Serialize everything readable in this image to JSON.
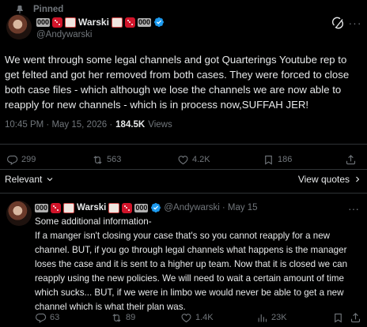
{
  "pinned": {
    "label": "Pinned"
  },
  "tweet": {
    "display_name": "Warski",
    "num_badge": "000",
    "handle": "@Andywarski",
    "text": "We went through some legal channels and got Quarterings Youtube rep to get felted and got her removed from both cases. They were forced to close both case files - which although we lose the channels we are now able to reapply for new channels - which is in process now,SUFFAH JER!",
    "time": "10:45 PM · May 15, 2026 ·",
    "views_count": "184.5K",
    "views_label": "Views",
    "stats": {
      "replies": "299",
      "reposts": "563",
      "likes": "4.2K",
      "bookmarks": "186"
    }
  },
  "controls": {
    "relevant": "Relevant",
    "view_quotes": "View quotes"
  },
  "reply": {
    "display_name": "Warski",
    "num_badge": "000",
    "handle": "@Andywarski",
    "date": "· May 15",
    "lines": [
      "Some additional information-",
      "If a manger isn't closing your case that's so you cannot reapply for a new channel. BUT, if you go through legal channels what happens is the manager loses the case and it is sent to a higher up team. Now that it is closed we can reapply using the new policies. We will need to wait a certain amount of time which sucks... BUT, if we were in limbo we would never be able to get a new channel which is what their plan was."
    ],
    "stats": {
      "replies": "63",
      "reposts": "89",
      "likes": "1.4K",
      "views": "23K"
    }
  },
  "colors": {
    "background": "#000000",
    "text": "#e7e9ea",
    "muted": "#71767b",
    "verified": "#1d9bf0",
    "divider": "#2f3336",
    "emoji_red": "#d2142a"
  }
}
